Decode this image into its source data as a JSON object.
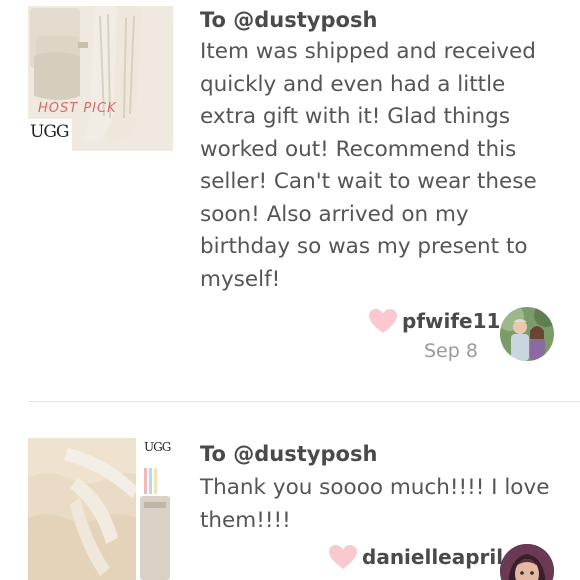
{
  "reviews": [
    {
      "to": "To @dustyposh",
      "text": "Item was shipped and received quickly and even had a little extra gift with it! Glad things worked out! Recommend this seller! Can't wait to wear these soon! Also arrived on my birthday so was my present to myself!",
      "username": "pfwife11",
      "date": "Sep 8",
      "thumb_brand": "UGG",
      "thumb_badge": "HOST PICK"
    },
    {
      "to": "To @dustyposh",
      "text": "Thank you soooo much!!!! I love them!!!!",
      "username": "danielleapril",
      "thumb_brand": "UGG"
    }
  ],
  "colors": {
    "heart": "#f9c9cf",
    "text": "#555555",
    "date": "#9a9a9a",
    "divider": "#e3e3e3"
  },
  "icons": [
    "heart-icon"
  ]
}
